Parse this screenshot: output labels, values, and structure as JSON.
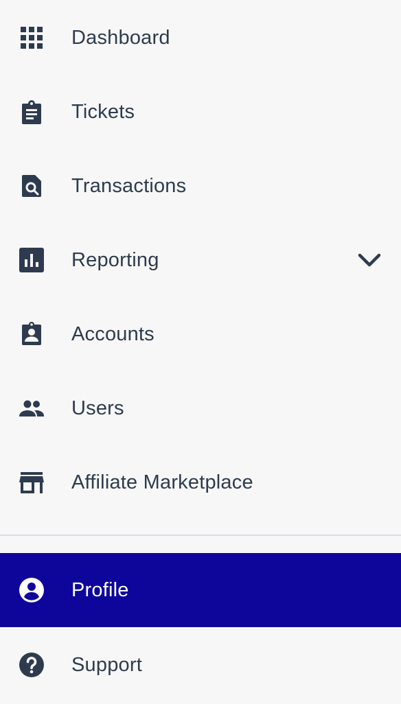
{
  "nav": {
    "items": [
      {
        "label": "Dashboard",
        "icon": "grid-icon"
      },
      {
        "label": "Tickets",
        "icon": "clipboard-icon"
      },
      {
        "label": "Transactions",
        "icon": "document-search-icon"
      },
      {
        "label": "Reporting",
        "icon": "bar-chart-icon"
      },
      {
        "label": "Accounts",
        "icon": "contact-card-icon"
      },
      {
        "label": "Users",
        "icon": "people-icon"
      },
      {
        "label": "Affiliate Marketplace",
        "icon": "storefront-icon"
      }
    ],
    "secondary": [
      {
        "label": "Profile",
        "icon": "account-circle-icon",
        "active": true
      },
      {
        "label": "Support",
        "icon": "help-circle-icon"
      }
    ]
  },
  "colors": {
    "background": "#f7f7f7",
    "text": "#2e3b4e",
    "active_bg": "#0e069b",
    "active_text": "#ffffff",
    "divider": "#d5dde5"
  }
}
